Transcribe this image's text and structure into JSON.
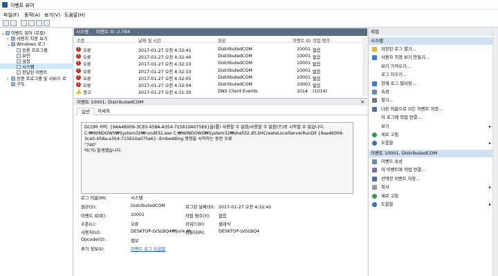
{
  "window": {
    "title": "이벤트 뷰어"
  },
  "menu": [
    "파일(F)",
    "동작(A)",
    "보기(V)",
    "도움말(H)"
  ],
  "tree": [
    {
      "label": "이벤트 뷰어 (로컬)",
      "indent": 0,
      "expand": "⌄"
    },
    {
      "label": "사용자 지정 보기",
      "indent": 1,
      "expand": "›"
    },
    {
      "label": "Windows 로그",
      "indent": 1,
      "expand": "⌄"
    },
    {
      "label": "응용 프로그램",
      "indent": 2,
      "expand": ""
    },
    {
      "label": "보안",
      "indent": 2,
      "expand": ""
    },
    {
      "label": "설정",
      "indent": 2,
      "expand": ""
    },
    {
      "label": "시스템",
      "indent": 2,
      "expand": "",
      "selected": true
    },
    {
      "label": "전달된 이벤트",
      "indent": 2,
      "expand": ""
    },
    {
      "label": "응용 프로그램 및 서비스 로",
      "indent": 1,
      "expand": "›"
    },
    {
      "label": "구독",
      "indent": 1,
      "expand": ""
    }
  ],
  "log_header": {
    "name": "시스템",
    "count": "이벤트 수: 2,784"
  },
  "columns": [
    "수준",
    "날짜 및 시간",
    "원본",
    "이벤트 ID",
    "작업 범주"
  ],
  "events": [
    {
      "level": "오류",
      "type": "error",
      "date": "2017-01-27 오전 4:32:41",
      "source": "DistributedCOM",
      "id": "10001",
      "cat": "없음"
    },
    {
      "level": "오류",
      "type": "error",
      "date": "2017-01-27 오전 4:32:40",
      "source": "DistributedCOM",
      "id": "10001",
      "cat": "없음"
    },
    {
      "level": "오류",
      "type": "error",
      "date": "2017-01-27 오전 4:32:10",
      "source": "DistributedCOM",
      "id": "10001",
      "cat": "없음"
    },
    {
      "level": "오류",
      "type": "error",
      "date": "2017-01-27 오전 4:32:10",
      "source": "DistributedCOM",
      "id": "10001",
      "cat": "없음"
    },
    {
      "level": "오류",
      "type": "error",
      "date": "2017-01-27 오전 4:32:05",
      "source": "DistributedCOM",
      "id": "10001",
      "cat": "없음"
    },
    {
      "level": "오류",
      "type": "error",
      "date": "2017-01-27 오전 4:32:04",
      "source": "DistributedCOM",
      "id": "10001",
      "cat": "없음"
    },
    {
      "level": "경고",
      "type": "warn",
      "date": "2017-01-27 오전 4:31:30",
      "source": "DNS Client Events",
      "id": "1014",
      "cat": "(1014)"
    }
  ],
  "detail": {
    "title": "이벤트 10001, DistributedCOM",
    "tabs": [
      "일반",
      "자세히"
    ],
    "message": "DCOM 서버: {9AA46009-3CE0-458A-A354-715610A075E6}을(를) 사용할 수 없음/사용할 수 없음(으)로 시작할 수 없습니다.\nC:₩WINDOWS₩System32₩rundll32.exe C:₩WINDOWS₩System32₩shell32.dll,SHCreateLocalServerRunDll {9aa46009-3ce0-458a-a354-715610a075e6} -Embedding 명령을 시작하는 동안 오류\n\"740\"\n이(가) 발생했습니다.",
    "props": {
      "log_name_label": "로그 이름(M):",
      "log_name": "시스템",
      "source_label": "원본(S):",
      "source": "DistributedCOM",
      "logged_label": "로그된 날짜(D):",
      "logged": "2017-01-27 오전 4:32:41",
      "event_id_label": "이벤트 ID(E):",
      "event_id": "10001",
      "category_label": "작업 범주(Y):",
      "category": "없음",
      "level_label": "수준(L):",
      "level": "오류",
      "keywords_label": "키워드(K):",
      "keywords": "클래식",
      "user_label": "사용자(U):",
      "user": "DESKTOP-LVSLBQ4₩Junk.M",
      "computer_label": "컴퓨터(R):",
      "computer": "DESKTOP-LVSLBQ4",
      "opcode_label": "Opcode(O):",
      "opcode": "정보",
      "more_label": "추가 정보(I):",
      "more": "이벤트 로그 도움말"
    }
  },
  "actions": {
    "title": "작업",
    "sec1": "시스템",
    "list1": [
      {
        "label": "저장된 로그 열기...",
        "icon": "folder-icon",
        "arrow": false
      },
      {
        "label": "사용자 지정 보기 만들기...",
        "icon": "filter-icon",
        "arrow": false
      },
      {
        "label": "보기 가져오기...",
        "icon": "",
        "arrow": false
      },
      {
        "label": "로그 지우기...",
        "icon": "",
        "arrow": false
      },
      {
        "label": "현재 로그 필터링...",
        "icon": "filter-icon",
        "arrow": false
      },
      {
        "label": "속성",
        "icon": "properties-icon",
        "arrow": false
      },
      {
        "label": "찾기...",
        "icon": "find-icon",
        "arrow": false
      },
      {
        "label": "다른 이름으로 모든 이벤트 저장...",
        "icon": "save-icon",
        "arrow": false
      },
      {
        "label": "이 로그에 작업 연결...",
        "icon": "",
        "arrow": false
      },
      {
        "label": "보기",
        "icon": "",
        "arrow": true
      },
      {
        "label": "새로 고침",
        "icon": "refresh-icon",
        "arrow": false
      },
      {
        "label": "도움말",
        "icon": "help-icon",
        "arrow": true
      }
    ],
    "sec2": "이벤트 10001, DistributedCOM",
    "list2": [
      {
        "label": "이벤트 속성",
        "icon": "properties-icon",
        "arrow": false
      },
      {
        "label": "이 이벤트에 작업 연결...",
        "icon": "task-icon",
        "arrow": false
      },
      {
        "label": "선택한 이벤트 저장...",
        "icon": "save-icon",
        "arrow": false
      },
      {
        "label": "복사",
        "icon": "copy-icon",
        "arrow": true
      },
      {
        "label": "새로 고침",
        "icon": "refresh-icon",
        "arrow": false
      },
      {
        "label": "도움말",
        "icon": "help-icon",
        "arrow": true
      }
    ]
  }
}
